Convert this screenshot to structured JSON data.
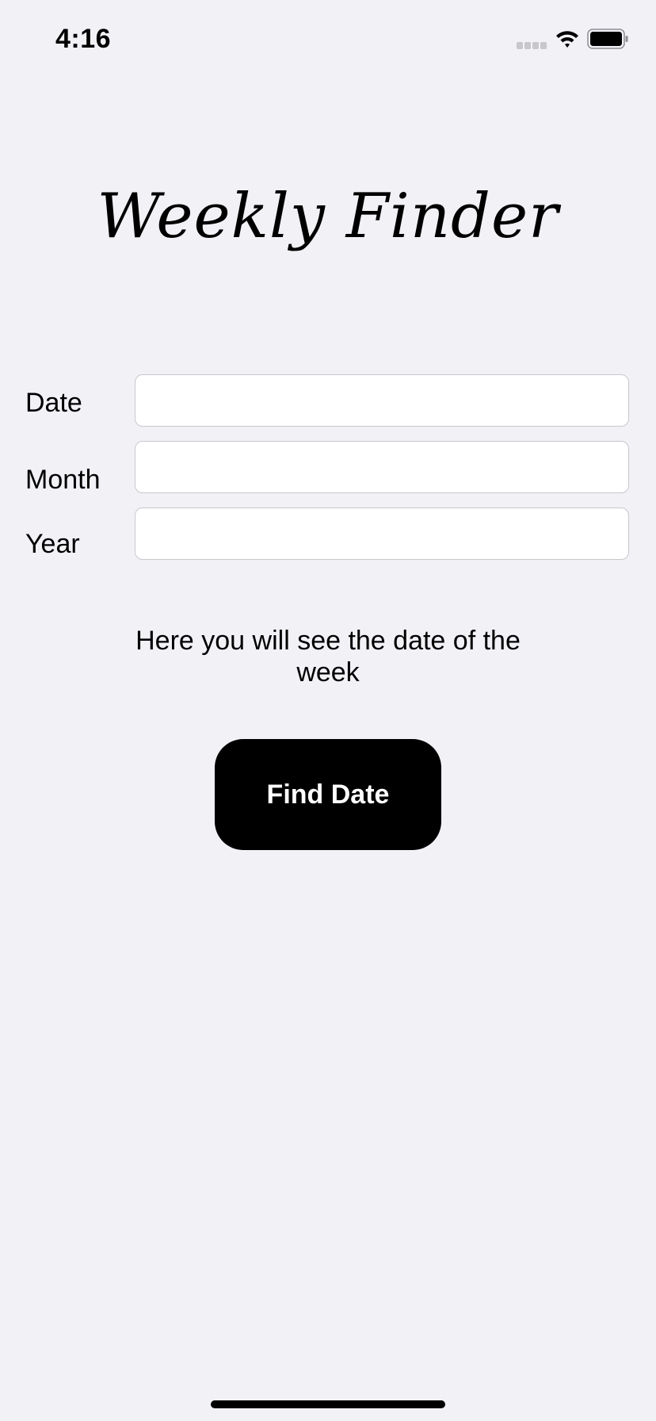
{
  "status_bar": {
    "time": "4:16"
  },
  "app": {
    "title": "Weekly Finder"
  },
  "form": {
    "date_label": "Date",
    "date_value": "",
    "month_label": "Month",
    "month_value": "",
    "year_label": "Year",
    "year_value": ""
  },
  "result": {
    "text": "Here you will see the date of the week"
  },
  "actions": {
    "find_label": "Find Date"
  },
  "colors": {
    "background": "#f2f1f6",
    "button": "#000000",
    "button_text": "#ffffff"
  }
}
